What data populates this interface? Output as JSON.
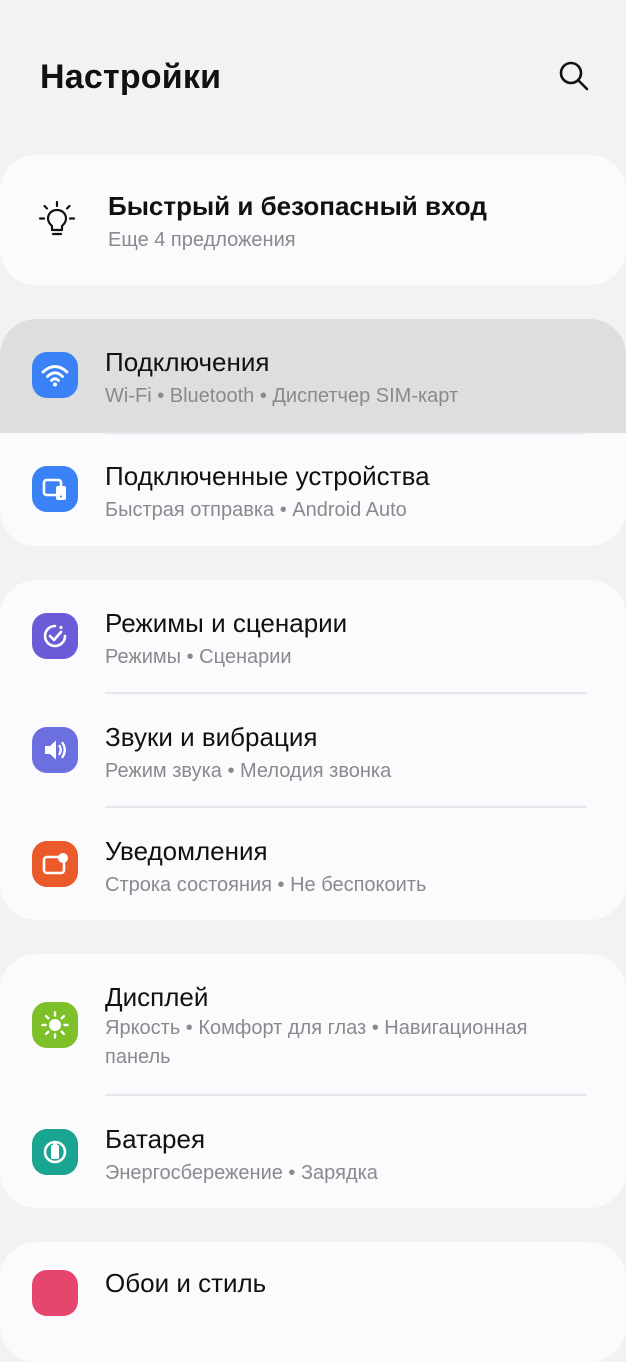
{
  "header": {
    "title": "Настройки",
    "search_icon": "search-icon"
  },
  "suggestion": {
    "icon": "lightbulb-icon",
    "title": "Быстрый и безопасный вход",
    "subtitle": "Еще 4 предложения"
  },
  "items": [
    {
      "icon": "wifi-icon",
      "color": "#3b82f6",
      "title": "Подключения",
      "subtitle": "Wi-Fi  •  Bluetooth  •  Диспетчер SIM-карт"
    },
    {
      "icon": "connected-devices-icon",
      "color": "#3b82f6",
      "title": "Подключенные устройства",
      "subtitle": "Быстрая отправка  •  Android Auto"
    },
    {
      "icon": "modes-icon",
      "color": "#6b5bd6",
      "title": "Режимы и сценарии",
      "subtitle": "Режимы  •  Сценарии"
    },
    {
      "icon": "sound-icon",
      "color": "#6b6fe0",
      "title": "Звуки и вибрация",
      "subtitle": "Режим звука  •  Мелодия звонка"
    },
    {
      "icon": "notifications-icon",
      "color": "#ea5a2a",
      "title": "Уведомления",
      "subtitle": "Строка состояния  •  Не беспокоить"
    },
    {
      "icon": "display-icon",
      "color": "#7ec02a",
      "title": "Дисплей",
      "subtitle": "Яркость  •  Комфорт для глаз  •  Навигационная панель"
    },
    {
      "icon": "battery-icon",
      "color": "#1aa592",
      "title": "Батарея",
      "subtitle": "Энергосбережение  •  Зарядка"
    },
    {
      "icon": "wallpaper-icon",
      "color": "#e6466e",
      "title": "Обои и стиль",
      "subtitle": ""
    }
  ]
}
